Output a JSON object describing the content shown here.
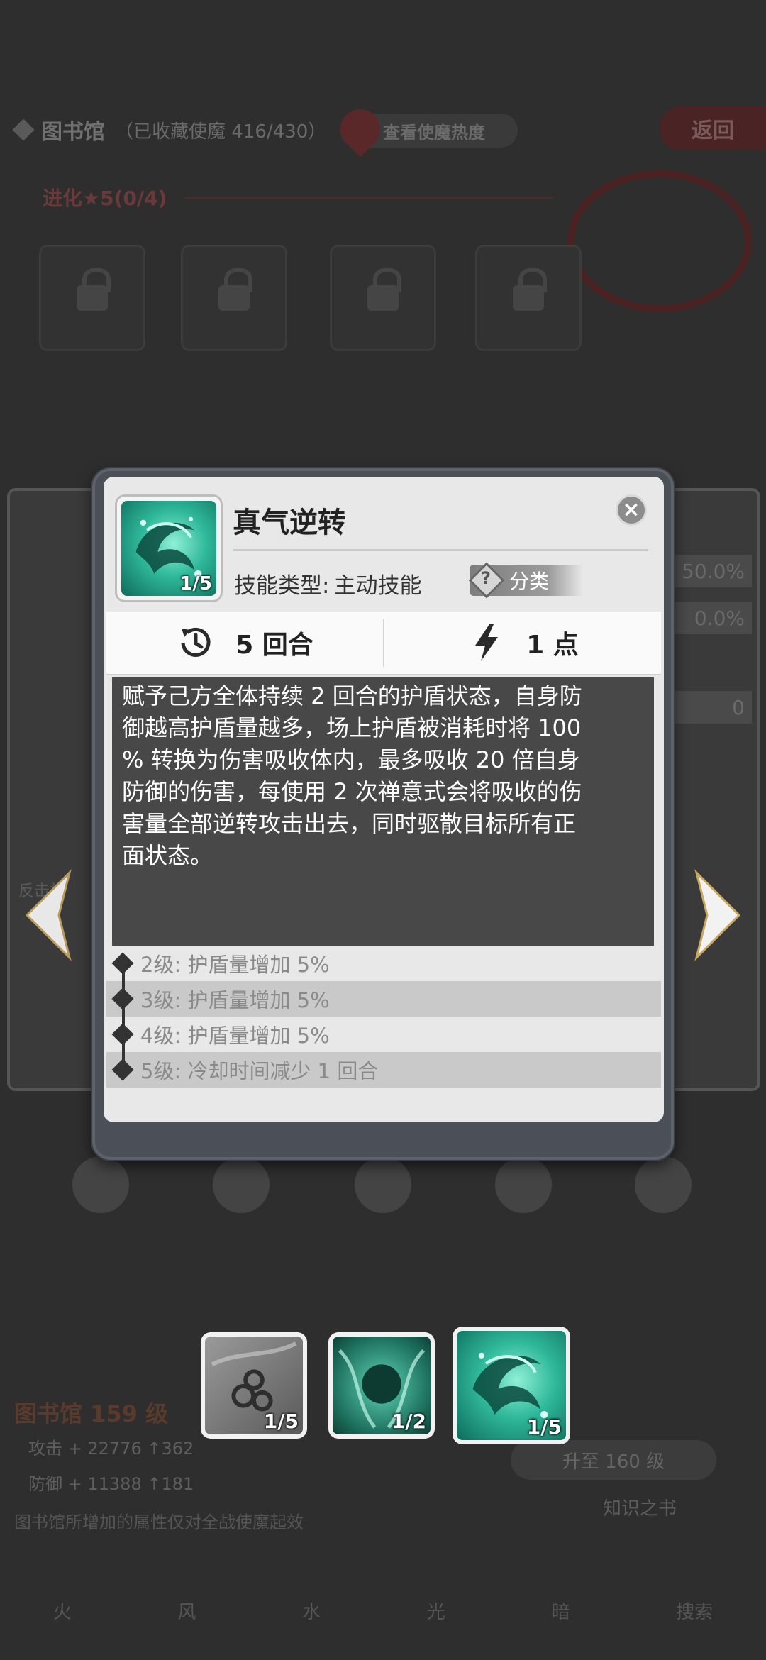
{
  "background": {
    "header_title": "图书馆",
    "header_count": "（已收藏使魔 416/430）",
    "hot_label": "查看使魔热度",
    "back_label": "返回",
    "evolve_label": "进化★5(0/4)",
    "right_stats": [
      "50.0%",
      "0.0%",
      "0"
    ],
    "side_label": "反击机",
    "library_level": "图书馆 159 级",
    "attack_text": "攻击 + 22776 ↑362",
    "defense_text": "防御 + 11388 ↑181",
    "note_text": "图书馆所增加的属性仅对全战使魔起效",
    "upgrade_label": "升至 160 级",
    "book_label": "知识之书",
    "tabs": [
      "火",
      "风",
      "水",
      "光",
      "暗",
      "搜索"
    ]
  },
  "popup": {
    "skill_name": "真气逆转",
    "skill_level_fraction": "1/5",
    "skill_type_label": "技能类型:",
    "skill_type_value": "主动技能",
    "category_label": "分类",
    "cooldown": "5 回合",
    "cost": "1 点",
    "description": "赋予己方全体持续 2 回合的护盾状态，自身防\n御越高护盾量越多，场上护盾被消耗时将 100\n% 转换为伤害吸收体内，最多吸收 20  倍自身\n防御的伤害，每使用 2 次禅意式会将吸收的伤\n害量全部逆转攻击出去，同时驱散目标所有正\n面状态。",
    "levels": [
      "2级:  护盾量增加 5%",
      "3级:  护盾量增加 5%",
      "4级:  护盾量增加 5%",
      "5级:  冷却时间减少 1 回合"
    ]
  },
  "skill_selector": [
    {
      "fraction": "1/5",
      "icon": "grey-cloud-skill-icon"
    },
    {
      "fraction": "1/2",
      "icon": "green-orb-skill-icon"
    },
    {
      "fraction": "1/5",
      "icon": "green-dragon-skill-icon",
      "selected": true
    }
  ],
  "colors": {
    "popup_frame": "#4b4f57",
    "description_bg": "#484848",
    "skill_teal": "#2fb89a"
  }
}
